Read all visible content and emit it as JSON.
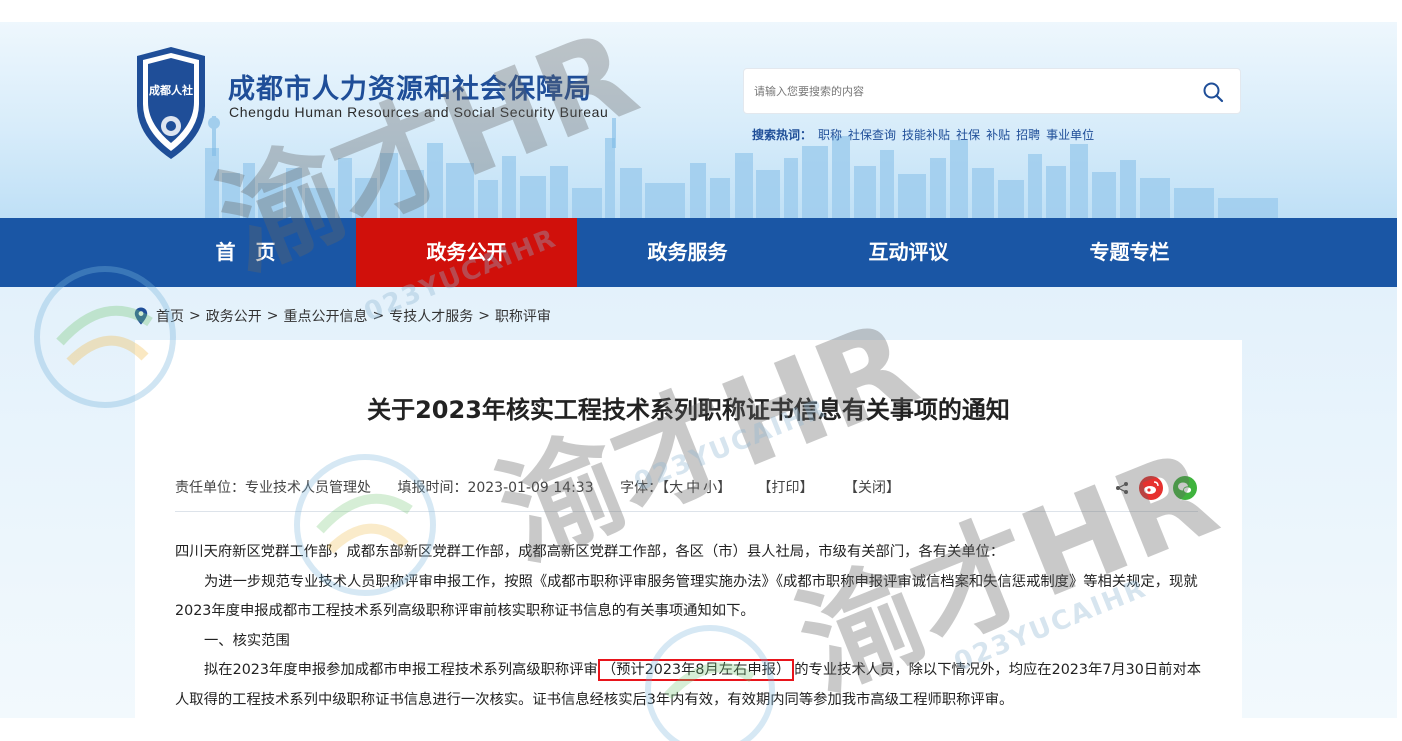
{
  "header": {
    "emblem_text": "成都人社",
    "title": "成都市人力资源和社会保障局",
    "subtitle": "Chengdu Human Resources and Social Security Bureau",
    "search_placeholder": "请输入您要搜索的内容",
    "hot_label": "搜索热词：",
    "hot_words": [
      "职称",
      "社保查询",
      "技能补贴",
      "社保",
      "补贴",
      "招聘",
      "事业单位"
    ]
  },
  "nav": {
    "items": [
      {
        "label": "首　页",
        "active": false
      },
      {
        "label": "政务公开",
        "active": true
      },
      {
        "label": "政务服务",
        "active": false
      },
      {
        "label": "互动评议",
        "active": false
      },
      {
        "label": "专题专栏",
        "active": false
      }
    ]
  },
  "breadcrumb": [
    "首页",
    "政务公开",
    "重点公开信息",
    "专技人才服务",
    "职称评审"
  ],
  "article": {
    "title": "关于2023年核实工程技术系列职称证书信息有关事项的通知",
    "meta": {
      "unit": "责任单位：专业技术人员管理处",
      "time": "填报时间：2023-01-09 14:33",
      "font_label": "字体：",
      "font_open": "【",
      "font_large": "大",
      "font_medium": "中",
      "font_small": "小",
      "font_close": "】",
      "print": "【打印】",
      "close": "【关闭】"
    },
    "p1": "四川天府新区党群工作部，成都东部新区党群工作部，成都高新区党群工作部，各区（市）县人社局，市级有关部门，各有关单位：",
    "p2": "为进一步规范专业技术人员职称评审申报工作，按照《成都市职称评审服务管理实施办法》《成都市职称申报评审诚信档案和失信惩戒制度》等相关规定，现就2023年度申报成都市工程技术系列高级职称评审前核实职称证书信息的有关事项通知如下。",
    "p3": "一、核实范围",
    "p4_before": "拟在2023年度申报参加成都市申报工程技术系列高级职称评审",
    "p4_highlight": "（预计2023年8月左右申报）",
    "p4_after": "的专业技术人员，除以下情况外，均应在2023年7月30日前对本人取得的工程技术系列中级职称证书信息进行一次核实。证书信息经核实后3年内有效，有效期内同等参加我市高级工程师职称评审。"
  },
  "watermark": {
    "main": "渝才HR",
    "sub": "023YUCAIHR"
  },
  "colors": {
    "brand_blue": "#1a56a5",
    "active_red": "#d0100b",
    "title_blue": "#1f4e98",
    "highlight_red": "#e8141b"
  }
}
